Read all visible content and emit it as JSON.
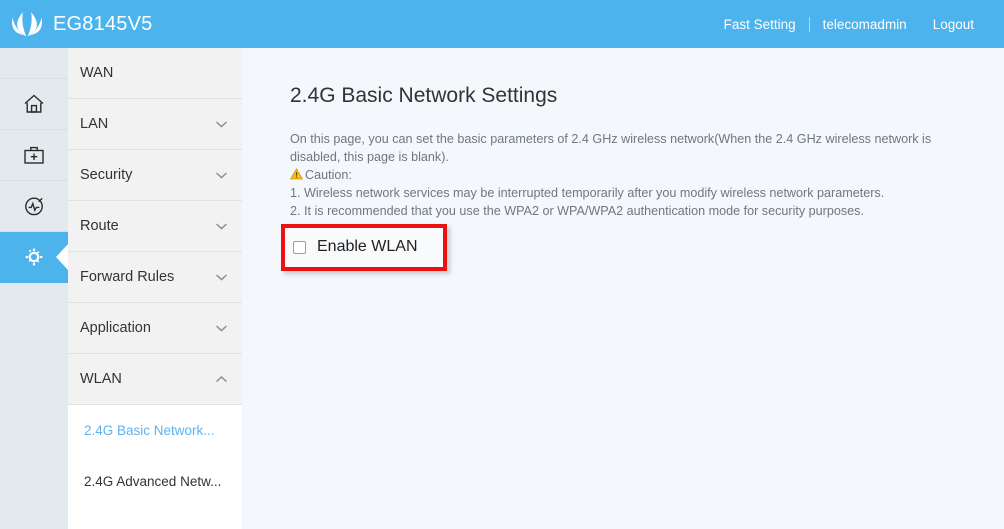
{
  "header": {
    "brand_name": "EG8145V5",
    "logo_icon": "huawei-flower-logo",
    "fast_setting": "Fast Setting",
    "username": "telecomadmin",
    "logout": "Logout"
  },
  "rail": {
    "items": [
      {
        "icon": "home-icon",
        "active": false
      },
      {
        "icon": "toolkit-icon",
        "active": false
      },
      {
        "icon": "diagnostics-gauge-icon",
        "active": false
      },
      {
        "icon": "gear-icon",
        "active": true
      }
    ]
  },
  "sidebar": {
    "items": [
      {
        "label": "WAN",
        "chevron": "none"
      },
      {
        "label": "LAN",
        "chevron": "down"
      },
      {
        "label": "Security",
        "chevron": "down"
      },
      {
        "label": "Route",
        "chevron": "down"
      },
      {
        "label": "Forward Rules",
        "chevron": "down"
      },
      {
        "label": "Application",
        "chevron": "down"
      },
      {
        "label": "WLAN",
        "chevron": "up"
      }
    ],
    "sub_items": [
      {
        "label": "2.4G Basic Network...",
        "active": true
      },
      {
        "label": "2.4G Advanced Netw...",
        "active": false
      }
    ]
  },
  "main": {
    "title": "2.4G Basic Network Settings",
    "description": "On this page, you can set the basic parameters of 2.4 GHz wireless network(When the 2.4 GHz wireless network is disabled, this page is blank).",
    "caution_label": "Caution:",
    "caution_icon": "warning-triangle-icon",
    "caution_items": [
      "1. Wireless network services may be interrupted temporarily after you modify wireless network parameters.",
      "2. It is recommended that you use the WPA2 or WPA/WPA2 authentication mode for security purposes."
    ],
    "enable_wlan_label": "Enable WLAN",
    "enable_wlan_checked": false
  },
  "colors": {
    "header_blue": "#4cb3ec",
    "accent_blue": "#5fb3ec",
    "highlight_red": "#ee1111",
    "rail_bg": "#e2eaee",
    "menu_bg": "#f2f2f2",
    "content_bg": "#f4f7fb",
    "warning_yellow": "#e8b923"
  }
}
